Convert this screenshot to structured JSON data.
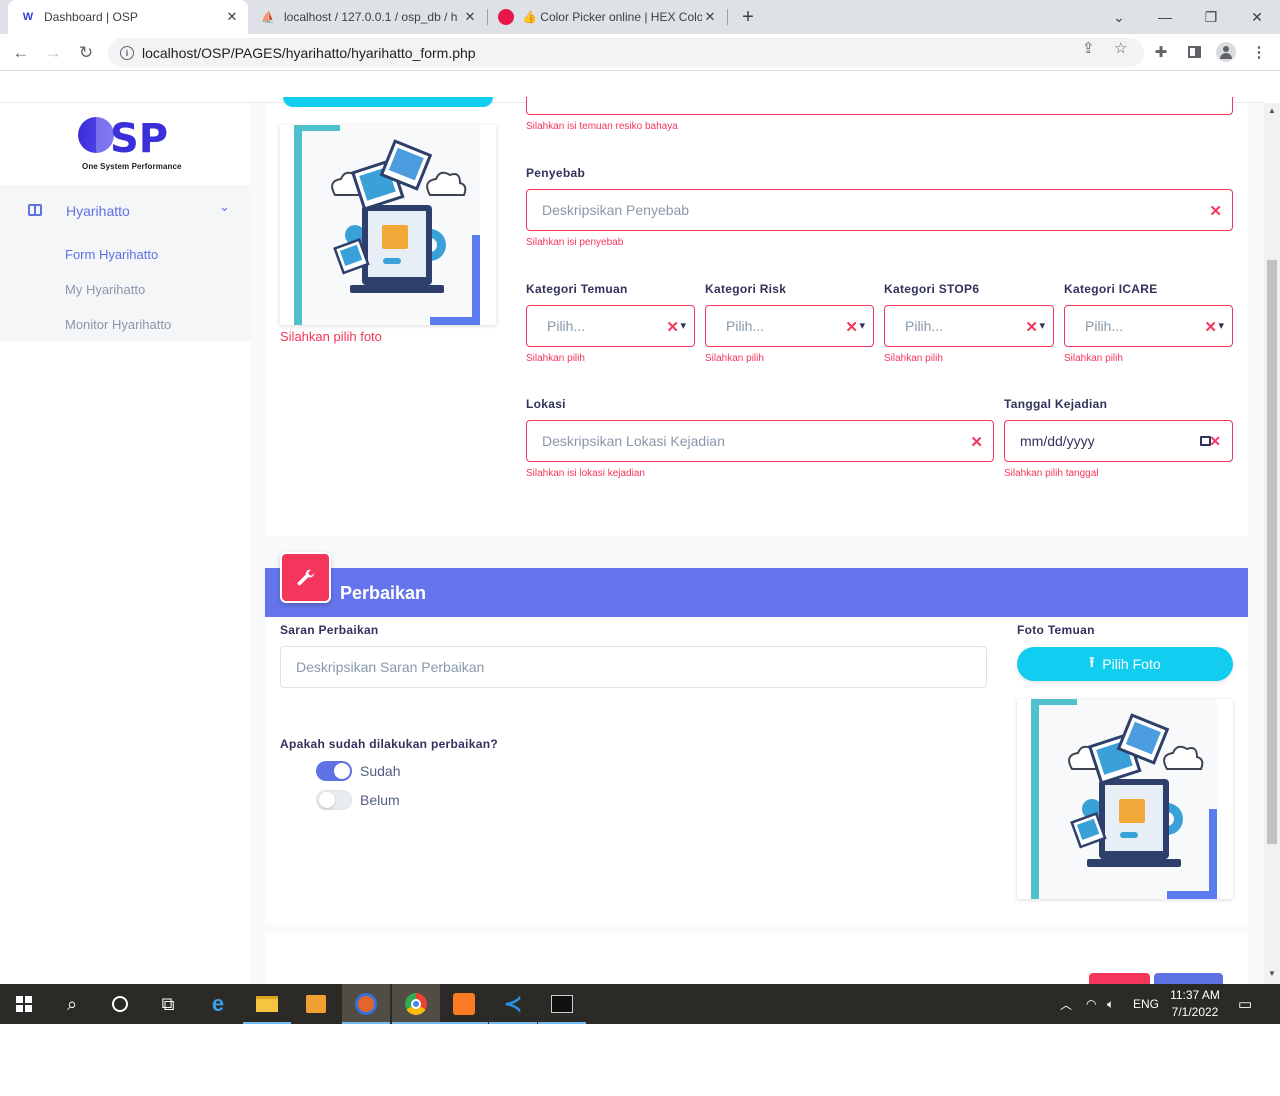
{
  "browser": {
    "tabs": [
      {
        "title": "Dashboard | OSP",
        "active": true
      },
      {
        "title": "localhost / 127.0.0.1 / osp_db / h",
        "active": false
      },
      {
        "title": "👍 Color Picker online | HEX Colo",
        "active": false
      }
    ],
    "new_tab": "+",
    "url": "localhost/OSP/PAGES/hyarihatto/hyarihatto_form.php"
  },
  "sidebar": {
    "logo_text": "OSP",
    "logo_subtitle": "One System Performance",
    "section_label": "Hyarihatto",
    "items": [
      {
        "label": "Form Hyarihatto",
        "active": true
      },
      {
        "label": "My Hyarihatto",
        "active": false
      },
      {
        "label": "Monitor Hyarihatto",
        "active": false
      }
    ]
  },
  "form1": {
    "photo_error": "Silahkan pilih foto",
    "temuan_error": "Silahkan isi temuan resiko bahaya",
    "penyebab": {
      "label": "Penyebab",
      "placeholder": "Deskripsikan Penyebab",
      "error": "Silahkan isi penyebab"
    },
    "categories": [
      {
        "label": "Kategori Temuan",
        "placeholder": "Pilih...",
        "error": "Silahkan pilih"
      },
      {
        "label": "Kategori Risk",
        "placeholder": "Pilih...",
        "error": "Silahkan pilih"
      },
      {
        "label": "Kategori STOP6",
        "placeholder": "Pilih...",
        "error": "Silahkan pilih"
      },
      {
        "label": "Kategori ICARE",
        "placeholder": "Pilih...",
        "error": "Silahkan pilih"
      }
    ],
    "lokasi": {
      "label": "Lokasi",
      "placeholder": "Deskripsikan Lokasi Kejadian",
      "error": "Silahkan isi lokasi kejadian"
    },
    "tanggal": {
      "label": "Tanggal Kejadian",
      "value": "mm/dd/yyyy",
      "error": "Silahkan pilih tanggal"
    }
  },
  "perbaikan": {
    "title": "Perbaikan",
    "saran_label": "Saran Perbaikan",
    "saran_placeholder": "Deskripsikan Saran Perbaikan",
    "foto_label": "Foto Temuan",
    "pilih_foto": "Pilih Foto",
    "question": "Apakah sudah dilakukan perbaikan?",
    "options": [
      {
        "label": "Sudah",
        "checked": true
      },
      {
        "label": "Belum",
        "checked": false
      }
    ]
  },
  "taskbar": {
    "lang": "ENG",
    "time": "11:37 AM",
    "date": "7/1/2022"
  },
  "colors": {
    "primary": "#5e72e4",
    "header_bar": "#6574ea",
    "danger": "#f5365c",
    "info": "#11cdef"
  }
}
